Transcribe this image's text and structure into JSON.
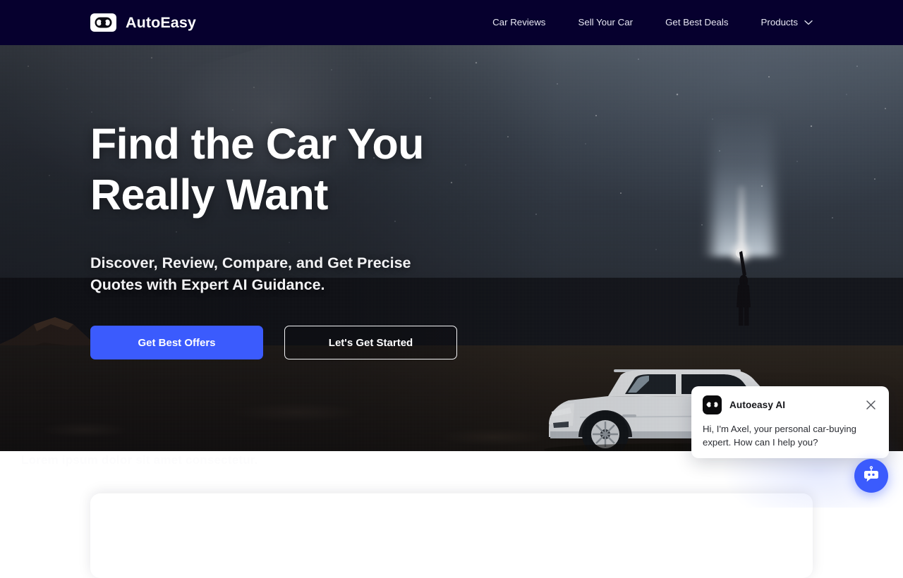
{
  "header": {
    "brand": {
      "name": "AutoEasy",
      "logo_icon": "car-top-view-icon"
    },
    "background_color": "#06002e",
    "nav": [
      {
        "label": "Car Reviews",
        "has_dropdown": false
      },
      {
        "label": "Sell Your Car",
        "has_dropdown": false
      },
      {
        "label": "Get Best Deals",
        "has_dropdown": false
      },
      {
        "label": "Products",
        "has_dropdown": true,
        "dropdown_icon": "chevron-down-icon"
      }
    ]
  },
  "hero": {
    "title": "Find the Car You Really Want",
    "subtitle": "Discover, Review, Compare, and Get Precise Quotes with Expert AI Guidance.",
    "background_description": "Night desert landscape with starry sky, rock formations, a person holding a flashlight beam, and a white SUV",
    "buttons": {
      "primary": {
        "label": "Get Best Offers",
        "color": "#3b5bfd"
      },
      "secondary": {
        "label": "Let's Get Started",
        "color": "transparent"
      }
    }
  },
  "below_hero": {
    "faint_text": "Lorem ipsum dolor sit amet consectetur."
  },
  "chat_widget": {
    "avatar_icon": "car-top-view-icon",
    "title": "Autoeasy AI",
    "close_icon": "close-icon",
    "message": "Hi, I'm Axel, your personal car-buying expert.  How can I help you?",
    "fab": {
      "icon": "chatbot-icon",
      "color": "#3b5bfd"
    }
  }
}
